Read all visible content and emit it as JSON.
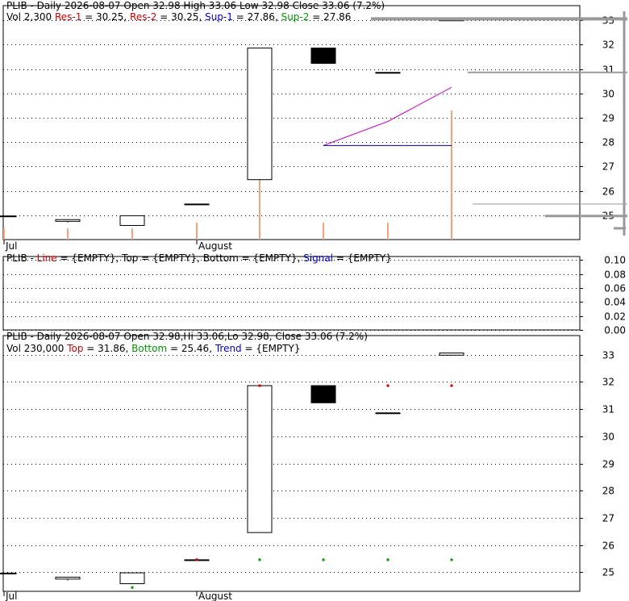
{
  "chart_data": [
    {
      "type": "candlestick",
      "legend": [
        {
          "text": "PLIB - Daily 2026-08-07 Open 32.98  High 33.06  Low 32.98  Close 33.06 (7.2%)",
          "color": "#000000"
        }
      ],
      "legend2": [
        {
          "text": "Vol 2,300 ",
          "color": "#000000"
        },
        {
          "text": "Res-1",
          "color": "#cc0000"
        },
        {
          "text": " = 30.25, ",
          "color": "#000000"
        },
        {
          "text": "Res-2",
          "color": "#cc0000"
        },
        {
          "text": " = 30.25, ",
          "color": "#000000"
        },
        {
          "text": "Sup-1",
          "color": "#0000cc"
        },
        {
          "text": " = 27.86, ",
          "color": "#000000"
        },
        {
          "text": "Sup-2",
          "color": "#009900"
        },
        {
          "text": " = 27.86",
          "color": "#000000"
        }
      ],
      "ylim": [
        24.0,
        33.6
      ],
      "yticks": [
        25,
        26,
        27,
        28,
        29,
        30,
        31,
        32,
        33
      ],
      "xlabels": [
        "Jul",
        "August"
      ],
      "candles": [
        {
          "open": 24.97,
          "high": 24.97,
          "low": 24.97,
          "close": 24.97
        },
        {
          "open": 24.75,
          "high": 24.82,
          "low": 24.7,
          "close": 24.82
        },
        {
          "open": 24.58,
          "high": 24.98,
          "low": 24.58,
          "close": 24.98
        },
        {
          "open": 25.46,
          "high": 25.46,
          "low": 25.46,
          "close": 25.46
        },
        {
          "open": 26.46,
          "high": 31.86,
          "low": 26.46,
          "close": 31.86
        },
        {
          "open": 31.86,
          "high": 31.86,
          "low": 31.23,
          "close": 31.23
        },
        {
          "open": 30.86,
          "high": 30.86,
          "low": 30.86,
          "close": 30.86
        },
        {
          "open": 32.98,
          "high": 33.06,
          "low": 32.98,
          "close": 33.06
        }
      ],
      "volume": [
        200,
        200,
        200,
        300,
        1200,
        300,
        300,
        2300
      ],
      "res_line": [
        [
          5,
          27.86
        ],
        [
          6,
          28.85
        ],
        [
          7,
          30.25
        ]
      ],
      "sup_line": [
        [
          5,
          27.86
        ],
        [
          7,
          27.86
        ]
      ]
    },
    {
      "type": "line",
      "legend": [
        {
          "text": "PLIB - ",
          "color": "#000000"
        },
        {
          "text": "Line",
          "color": "#cc0000"
        },
        {
          "text": " = {EMPTY}, ",
          "color": "#000000"
        },
        {
          "text": "Top",
          "color": "#000000"
        },
        {
          "text": " = {EMPTY}, ",
          "color": "#000000"
        },
        {
          "text": "Bottom",
          "color": "#000000"
        },
        {
          "text": " = {EMPTY}, ",
          "color": "#000000"
        },
        {
          "text": "Signal",
          "color": "#0000cc"
        },
        {
          "text": " = {EMPTY}",
          "color": "#000000"
        }
      ],
      "ylim": [
        0,
        0.105
      ],
      "yticks": [
        "0.00",
        "0.02",
        "0.04",
        "0.06",
        "0.08",
        "0.10"
      ]
    },
    {
      "type": "candlestick",
      "legend": [
        {
          "text": "PLIB - Daily 2026-08-07 Open 32.98,Hi 33.06,Lo 32.98, Close 33.06 (7.2%)",
          "color": "#000000"
        }
      ],
      "legend2": [
        {
          "text": "Vol 230,000 ",
          "color": "#000000"
        },
        {
          "text": "Top",
          "color": "#cc0000"
        },
        {
          "text": " = 31.86, ",
          "color": "#000000"
        },
        {
          "text": "Bottom",
          "color": "#009900"
        },
        {
          "text": " = 25.46, ",
          "color": "#000000"
        },
        {
          "text": "Trend",
          "color": "#0000cc"
        },
        {
          "text": " = {EMPTY}",
          "color": "#000000"
        }
      ],
      "ylim": [
        24.3,
        33.7
      ],
      "yticks": [
        25,
        26,
        27,
        28,
        29,
        30,
        31,
        32,
        33
      ],
      "xlabels": [
        "Jul",
        "August"
      ],
      "candles": [
        {
          "open": 24.97,
          "high": 24.97,
          "low": 24.97,
          "close": 24.97
        },
        {
          "open": 24.75,
          "high": 24.82,
          "low": 24.7,
          "close": 24.82
        },
        {
          "open": 24.58,
          "high": 24.98,
          "low": 24.58,
          "close": 24.98
        },
        {
          "open": 25.46,
          "high": 25.46,
          "low": 25.46,
          "close": 25.46
        },
        {
          "open": 26.46,
          "high": 31.86,
          "low": 26.46,
          "close": 31.86
        },
        {
          "open": 31.86,
          "high": 31.86,
          "low": 31.23,
          "close": 31.23
        },
        {
          "open": 30.86,
          "high": 30.86,
          "low": 30.86,
          "close": 30.86
        },
        {
          "open": 32.98,
          "high": 33.06,
          "low": 32.98,
          "close": 33.06
        }
      ],
      "top_markers": [
        [
          3,
          25.46
        ],
        [
          4,
          31.86
        ],
        [
          6,
          31.86
        ],
        [
          7,
          31.86
        ]
      ],
      "bottom_markers": [
        [
          2,
          24.44
        ],
        [
          4,
          25.46
        ],
        [
          5,
          25.46
        ],
        [
          6,
          25.46
        ],
        [
          7,
          25.46
        ]
      ]
    }
  ]
}
